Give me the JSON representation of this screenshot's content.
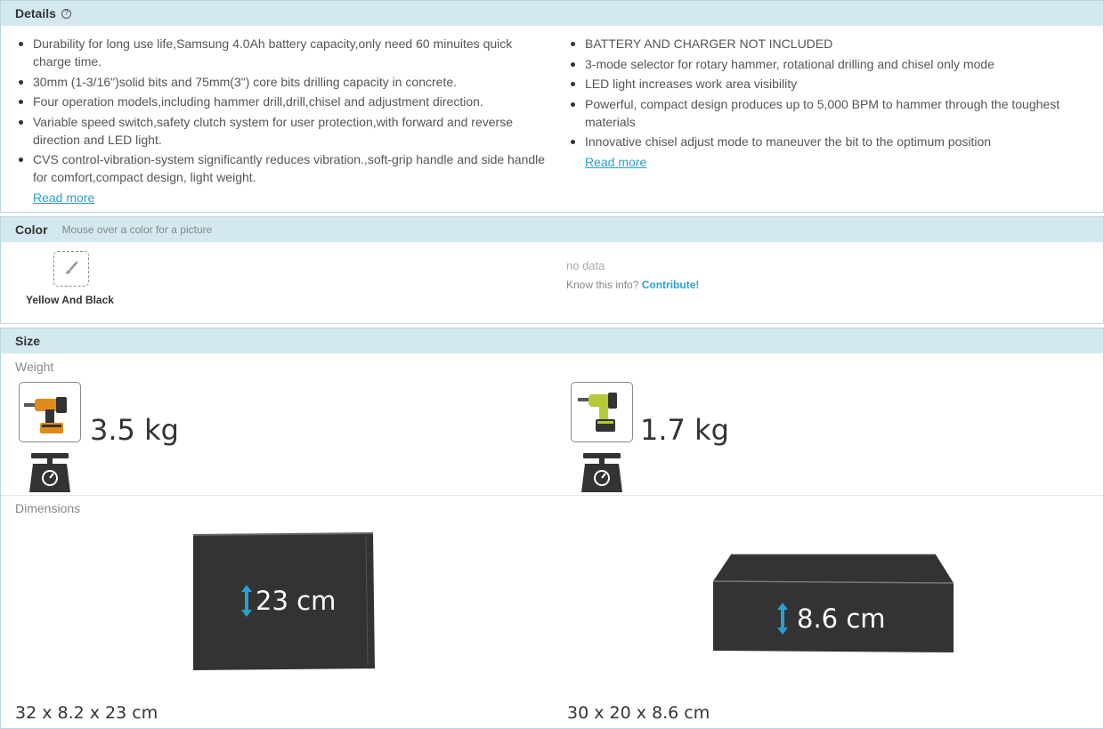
{
  "details": {
    "title": "Details",
    "help_icon": "?",
    "left_items": [
      "Durability for long use life,Samsung 4.0Ah battery capacity,only need 60 minuites quick charge time.",
      "30mm (1-3/16\")solid bits and 75mm(3\") core bits drilling capacity in concrete.",
      "Four operation models,including hammer drill,drill,chisel and adjustment direction.",
      "Variable speed switch,safety clutch system for user protection,with forward and reverse direction and LED light.",
      "CVS control-vibration-system significantly reduces vibration.,soft-grip handle and side handle for comfort,compact design, light weight."
    ],
    "right_items": [
      "BATTERY AND CHARGER NOT INCLUDED",
      "3-mode selector for rotary hammer, rotational drilling and chisel only mode",
      "LED light increases work area visibility",
      "Powerful, compact design produces up to 5,000 BPM to hammer through the toughest materials",
      "Innovative chisel adjust mode to maneuver the bit to the optimum position"
    ],
    "read_more": "Read more"
  },
  "color": {
    "title": "Color",
    "subtitle": "Mouse over a color for a picture",
    "swatch_name": "Yellow And Black",
    "no_data": "no data",
    "know_prefix": "Know this info?",
    "contribute": "Contribute!"
  },
  "size": {
    "title": "Size",
    "weight_label": "Weight",
    "dimensions_label": "Dimensions",
    "left": {
      "weight": "3.5 kg",
      "height_label": "23 cm",
      "dims": "32 x 8.2 x 23 cm"
    },
    "right": {
      "weight": "1.7 kg",
      "height_label": "8.6 cm",
      "dims": "30 x 20 x 8.6 cm"
    }
  },
  "colors": {
    "header_bg": "#d3e8ef",
    "accent": "#2a9fd0",
    "box": "#333333"
  }
}
